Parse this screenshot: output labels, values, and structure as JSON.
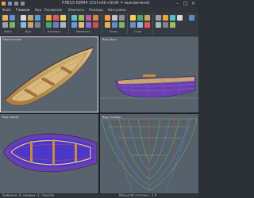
{
  "app": {
    "title": "РЛЕ15 КИМ4 (Ctrl+Alt+Shift = выключено)"
  },
  "ribbon": {
    "tabs": [
      "Файл",
      "Главная",
      "Вид",
      "Рисование",
      "Изменить",
      "Размеры",
      "Настройки"
    ],
    "groups": [
      "Файл",
      "Вид",
      "Рисовать",
      "Изменить",
      "Стиль",
      "Слои"
    ]
  },
  "viewports": {
    "perspective": "Перспектива",
    "side": "Вид сбоку",
    "top": "Вид сверху",
    "front": "Вид спереди"
  },
  "status": {
    "left": "Выбрано: 0, кривых: 1, Чертёж",
    "right": "Масштаб сеточки : 1.0"
  },
  "colors": {
    "accent": "#e8a33a",
    "selection": "#ff9a2e",
    "viewport_bg": "#55606a",
    "hull_wood": "#c9a66b"
  }
}
